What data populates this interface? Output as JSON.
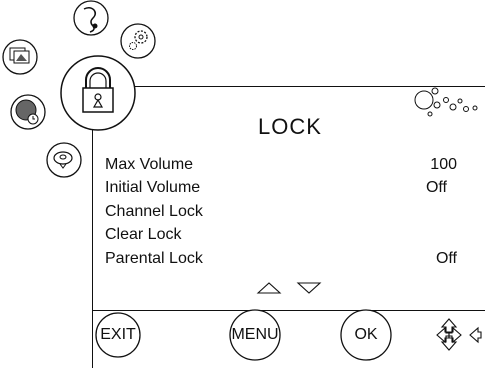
{
  "menu": {
    "title": "LOCK",
    "items": [
      {
        "label": "Max Volume",
        "value": "100"
      },
      {
        "label": "Initial Volume",
        "value": "Off"
      },
      {
        "label": "Channel Lock",
        "value": ""
      },
      {
        "label": "Clear Lock",
        "value": ""
      },
      {
        "label": "Parental Lock",
        "value": "Off"
      }
    ]
  },
  "side_icons": [
    "picture-icon",
    "sound-icon",
    "settings-icon",
    "time-icon",
    "tv-icon",
    "lock-icon"
  ],
  "buttons": {
    "exit": "EXIT",
    "menu": "MENU",
    "ok": "OK"
  }
}
